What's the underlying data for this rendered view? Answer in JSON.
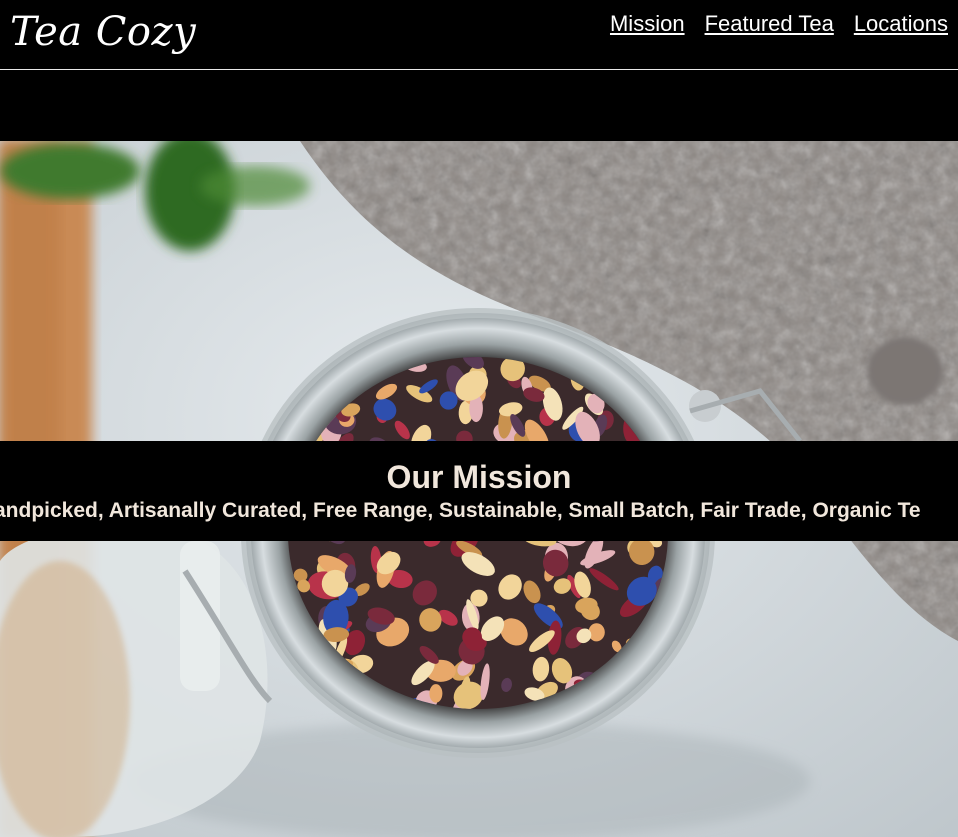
{
  "brand": {
    "logo_text": "Tea Cozy"
  },
  "nav": {
    "items": [
      {
        "label": "Mission"
      },
      {
        "label": "Featured Tea"
      },
      {
        "label": "Locations"
      }
    ]
  },
  "hero": {
    "image_subject": "open glass jar of loose leaf tea"
  },
  "mission": {
    "title": "Our Mission",
    "tagline": "andpicked, Artisanally Curated, Free Range, Sustainable, Small Batch, Fair Trade, Organic Te"
  },
  "colors": {
    "header_bg": "#000000",
    "nav_text": "#ffffff",
    "mission_text": "#f1e7dc"
  }
}
